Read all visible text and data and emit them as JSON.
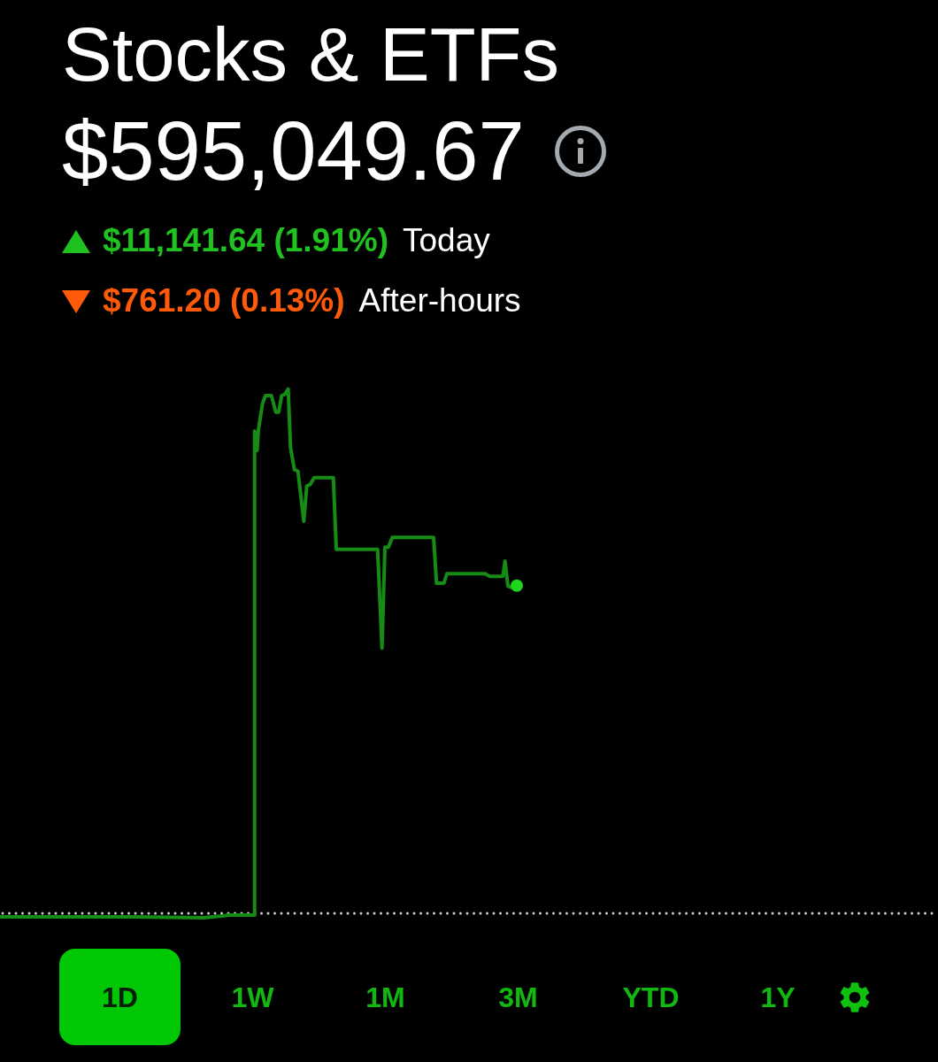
{
  "header": {
    "title": "Stocks & ETFs",
    "value": "$595,049.67"
  },
  "changes": [
    {
      "kind": "gain",
      "amount": "$11,141.64 (1.91%)",
      "label": "Today"
    },
    {
      "kind": "loss",
      "amount": "$761.20 (0.13%)",
      "label": "After-hours"
    }
  ],
  "ranges": [
    {
      "label": "1D",
      "selected": true
    },
    {
      "label": "1W",
      "selected": false
    },
    {
      "label": "1M",
      "selected": false
    },
    {
      "label": "3M",
      "selected": false
    },
    {
      "label": "YTD",
      "selected": false
    },
    {
      "label": "1Y",
      "selected": false
    }
  ]
}
